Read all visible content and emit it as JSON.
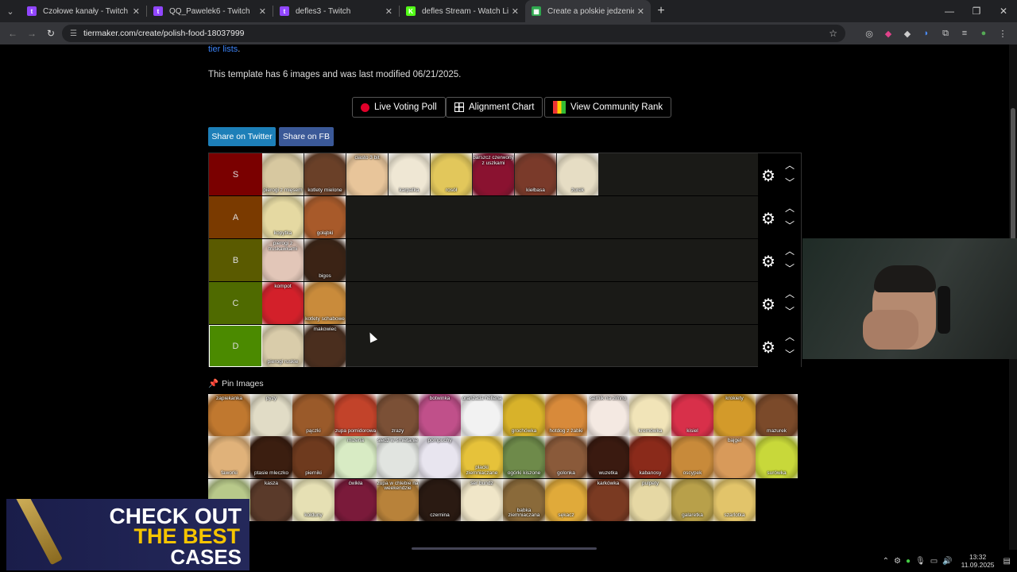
{
  "tabs": [
    {
      "title": "Czołowe kanały - Twitch",
      "color": "#9146ff",
      "glyph": "t"
    },
    {
      "title": "QQ_Pawelek6 - Twitch",
      "color": "#9146ff",
      "glyph": "t"
    },
    {
      "title": "defles3 - Twitch",
      "color": "#9146ff",
      "glyph": "t"
    },
    {
      "title": "defles Stream - Watch Live on K",
      "color": "#53fc18",
      "glyph": "K"
    },
    {
      "title": "Create a polskie jedzenie i napo",
      "color": "#2fa84f",
      "glyph": "▦",
      "active": true
    }
  ],
  "url": "tiermaker.com/create/polish-food-18037999",
  "page": {
    "tier_link": "tier lists",
    "info": "This template has 6 images and was last modified 06/21/2025.",
    "buttons": [
      "Live Voting Poll",
      "Alignment Chart",
      "View Community Rank"
    ],
    "share": [
      "Share on Twitter",
      "Share on FB"
    ],
    "pin_title": "Pin Images"
  },
  "tiers": [
    {
      "label": "S",
      "color": "#7a0000",
      "items": [
        {
          "name": "pierogi z mięsem",
          "bg": "#d7c8a0"
        },
        {
          "name": "kotlety mielone",
          "bg": "#6a4028"
        },
        {
          "name": "ciasto 3 bit",
          "bg": "#e8c59a",
          "top": true
        },
        {
          "name": "karpatka",
          "bg": "#efe7d4"
        },
        {
          "name": "rosół",
          "bg": "#e2c75b"
        },
        {
          "name": "barszcz czerwony z uszkami",
          "bg": "#8a1230",
          "top": true
        },
        {
          "name": "kiełbasa",
          "bg": "#7a3a2a"
        },
        {
          "name": "żurek",
          "bg": "#e6ddc4"
        }
      ]
    },
    {
      "label": "A",
      "color": "#7a3a00",
      "items": [
        {
          "name": "kopytka",
          "bg": "#e5d9a2"
        },
        {
          "name": "gołąbki",
          "bg": "#a85a2a"
        }
      ]
    },
    {
      "label": "B",
      "color": "#5a5a00",
      "items": [
        {
          "name": "pierogi z truskawkami",
          "bg": "#e2c6b8",
          "top": true
        },
        {
          "name": "bigos",
          "bg": "#3b2315"
        }
      ]
    },
    {
      "label": "C",
      "color": "#4f6a00",
      "items": [
        {
          "name": "kompot",
          "bg": "#d3202a",
          "top": true
        },
        {
          "name": "kotlety schabowe",
          "bg": "#c98b3b"
        }
      ]
    },
    {
      "label": "D",
      "color": "#4b8a00",
      "items": [
        {
          "name": "pierogi ruskie",
          "bg": "#d9ccaa"
        },
        {
          "name": "makowiec",
          "bg": "#4a2e1e",
          "top": true
        }
      ]
    }
  ],
  "pool": [
    {
      "name": "zapiekanka",
      "bg": "#c0782f",
      "top": true
    },
    {
      "name": "pyzy",
      "bg": "#e1dcc6",
      "top": true
    },
    {
      "name": "pączki",
      "bg": "#9a5a2a"
    },
    {
      "name": "zupa pomidorowa",
      "bg": "#c2432a"
    },
    {
      "name": "zrazy",
      "bg": "#7b5036"
    },
    {
      "name": "botwinka",
      "bg": "#c0508a",
      "top": true
    },
    {
      "name": "oranżada hellena",
      "bg": "#f2f2f2",
      "top": true
    },
    {
      "name": "grochówka",
      "bg": "#d8b22a"
    },
    {
      "name": "hotdog z żabki",
      "bg": "#d88a3a"
    },
    {
      "name": "sernik na zimno",
      "bg": "#f4e9e2",
      "top": true
    },
    {
      "name": "kremówka",
      "bg": "#f1e4b8"
    },
    {
      "name": "kisiel",
      "bg": "#d8304a"
    },
    {
      "name": "krokiety",
      "bg": "#d39a2a",
      "top": true
    },
    {
      "name": "mazurek",
      "bg": "#7b4a2a"
    },
    {
      "name": "faworki",
      "bg": "#e0b27a"
    },
    {
      "name": "ptasie mleczko",
      "bg": "#3b1e10"
    },
    {
      "name": "pierniki",
      "bg": "#6e3a1e"
    },
    {
      "name": "mizeria",
      "bg": "#d8ebc4",
      "top": true
    },
    {
      "name": "śledź w śmietanie",
      "bg": "#e1e4e0",
      "top": true
    },
    {
      "name": "pompuchy",
      "bg": "#e8e5ef",
      "top": true
    },
    {
      "name": "placki ziemniaczane",
      "bg": "#e6c23a"
    },
    {
      "name": "ogórki kiszone",
      "bg": "#6e8a4a"
    },
    {
      "name": "golonka",
      "bg": "#8a5a3a"
    },
    {
      "name": "wuzetka",
      "bg": "#3a1a10"
    },
    {
      "name": "kabanosy",
      "bg": "#8a2a1a"
    },
    {
      "name": "oscypek",
      "bg": "#c88a3a"
    },
    {
      "name": "bajgel",
      "bg": "#d89a5a",
      "top": true
    },
    {
      "name": "surówka",
      "bg": "#c8d83a"
    },
    {
      "name": "",
      "bg": "#b8c98a"
    },
    {
      "name": "kasza",
      "bg": "#5a3a2a",
      "top": true
    },
    {
      "name": "kołduny",
      "bg": "#e6e0b4"
    },
    {
      "name": "ćwikła",
      "bg": "#7a1a3a",
      "top": true
    },
    {
      "name": "zupa w chlebie na weekendzie",
      "bg": "#b8823a",
      "top": true
    },
    {
      "name": "czernina",
      "bg": "#2a1a12"
    },
    {
      "name": "ser bundz",
      "bg": "#f0e6c8",
      "top": true
    },
    {
      "name": "babka ziemniaczana",
      "bg": "#8a6a3a"
    },
    {
      "name": "sękacz",
      "bg": "#e0aa3a"
    },
    {
      "name": "karkówka",
      "bg": "#7a3a22",
      "top": true
    },
    {
      "name": "pulpety",
      "bg": "#e6d8a4",
      "top": true
    },
    {
      "name": "galaretka",
      "bg": "#b8a04a"
    },
    {
      "name": "szarlotka",
      "bg": "#e2c46a"
    }
  ],
  "ad": {
    "line1": "CHECK OUT",
    "line2": "THE BEST",
    "line3": "CASES"
  },
  "clock": {
    "time": "13:32",
    "date": "11.09.2025"
  }
}
